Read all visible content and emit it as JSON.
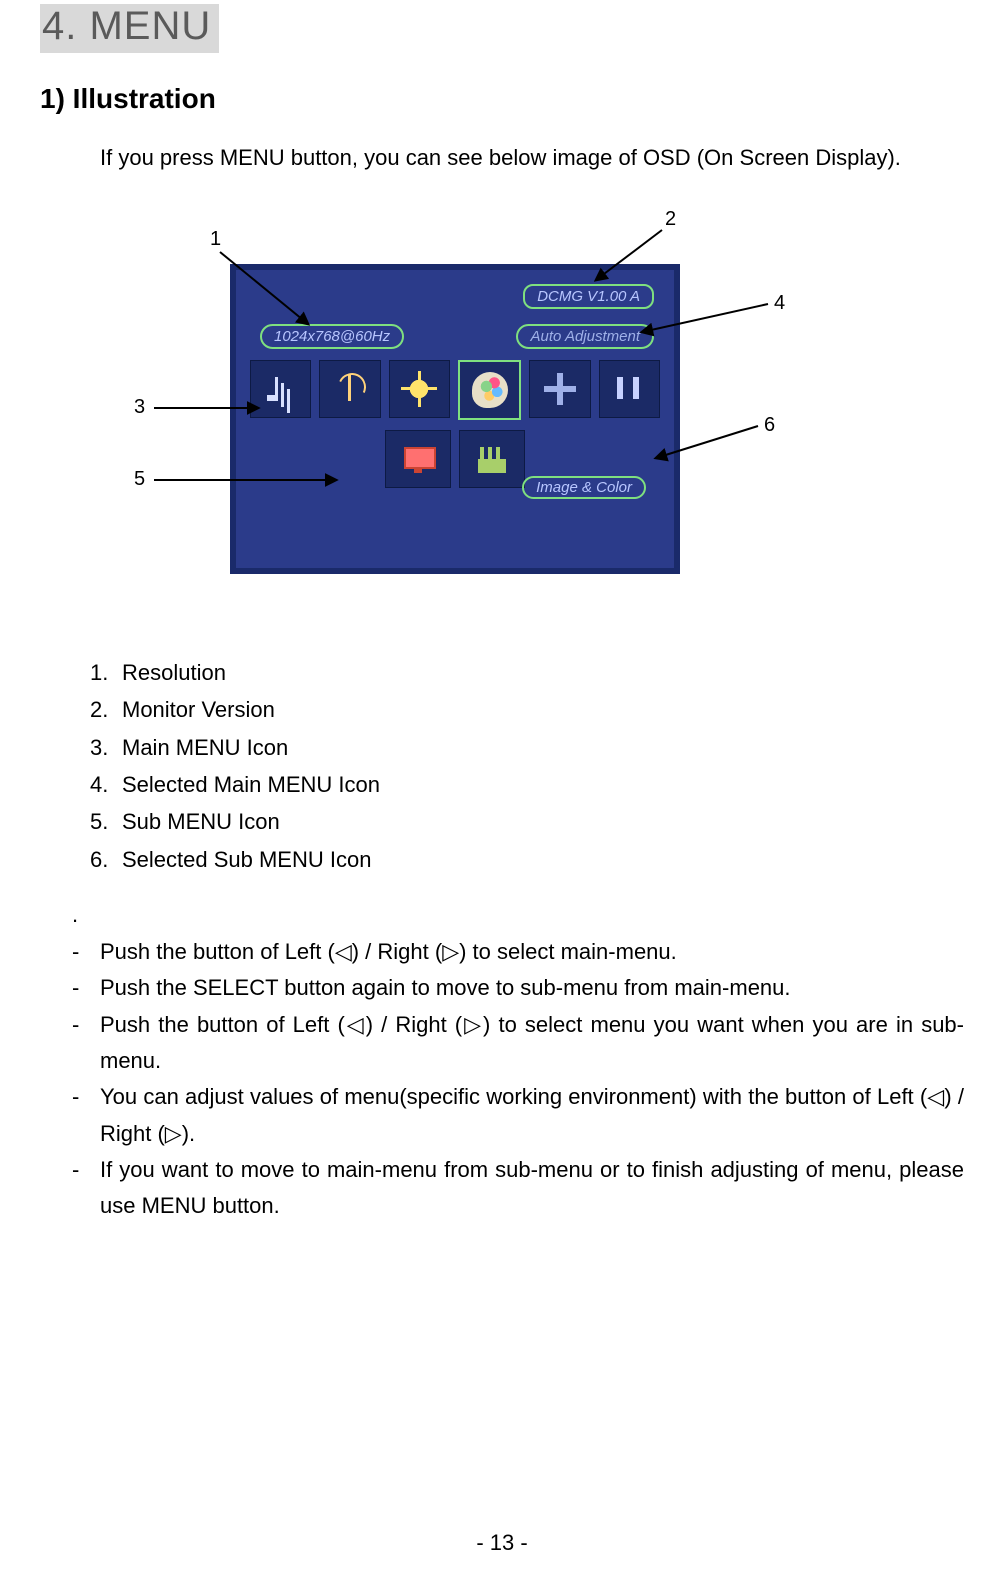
{
  "heading": "4. MENU",
  "subheading": "1) Illustration",
  "intro": "If you press MENU button, you can see below image of OSD (On Screen Display).",
  "callouts": {
    "c1": "1",
    "c2": "2",
    "c3": "3",
    "c4": "4",
    "c5": "5",
    "c6": "6"
  },
  "osd": {
    "version": "DCMG V1.00 A",
    "resolution": "1024x768@60Hz",
    "auto": "Auto Adjustment",
    "sub_label": "Image & Color"
  },
  "legend": [
    {
      "n": "1.",
      "t": "Resolution"
    },
    {
      "n": "2.",
      "t": "Monitor Version"
    },
    {
      "n": "3.",
      "t": "Main MENU Icon"
    },
    {
      "n": "4.",
      "t": "Selected Main MENU Icon"
    },
    {
      "n": "5.",
      "t": "Sub MENU Icon"
    },
    {
      "n": "6.",
      "t": "Selected Sub MENU Icon"
    }
  ],
  "solo_dot": ".",
  "bullets": [
    "Push the button of Left (◁) / Right (▷) to select main-menu.",
    "Push the SELECT button again to move to sub-menu from main-menu.",
    "Push the button of Left (◁) / Right (▷) to select menu you want when you are in sub-menu.",
    "You can adjust values of menu(specific working environment) with the button of Left (◁) / Right (▷).",
    "If you want to move to main-menu from sub-menu or to finish adjusting of menu, please use MENU button."
  ],
  "page_number": "- 13 -"
}
